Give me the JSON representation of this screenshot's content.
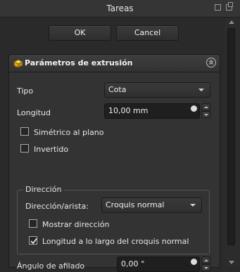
{
  "window": {
    "title": "Tareas"
  },
  "buttons": {
    "ok": "OK",
    "cancel": "Cancel"
  },
  "panel": {
    "title": "Parámetros de extrusión",
    "icon": "pad-icon",
    "collapse_icon": "collapse-icon"
  },
  "fields": {
    "tipo": {
      "label": "Tipo",
      "value": "Cota"
    },
    "longitud": {
      "label": "Longitud",
      "value": "10,00 mm"
    },
    "simetrico": {
      "label": "Simétrico al plano",
      "checked": false
    },
    "invertido": {
      "label": "Invertido",
      "checked": false
    }
  },
  "direccion": {
    "group_title": "Dirección",
    "arista_label": "Dirección/arista:",
    "arista_value": "Croquis normal",
    "mostrar": {
      "label": "Mostrar dirección",
      "checked": false
    },
    "longitud_croquis": {
      "label": "Longitud a lo largo del croquis normal",
      "checked": true
    }
  },
  "afilado": {
    "label": "Ángulo de afilado",
    "value": "0,00 °"
  },
  "colors": {
    "accent": "#f0c419",
    "background": "#2a2a2a",
    "panel": "#333333"
  }
}
